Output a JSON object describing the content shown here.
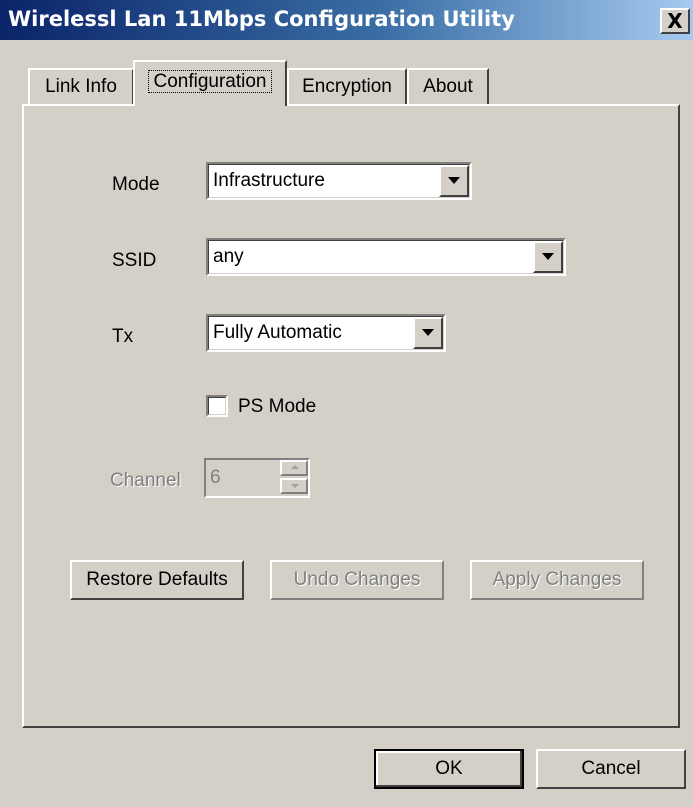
{
  "window": {
    "title": "Wirelessl Lan 11Mbps Configuration Utility",
    "close_label": "X"
  },
  "tabs": [
    {
      "label": "Link Info"
    },
    {
      "label": "Configuration"
    },
    {
      "label": "Encryption"
    },
    {
      "label": "About"
    }
  ],
  "active_tab": "Configuration",
  "form": {
    "mode_label": "Mode",
    "mode_value": "Infrastructure",
    "ssid_label": "SSID",
    "ssid_value": "any",
    "tx_label": "Tx",
    "tx_value": "Fully Automatic",
    "ps_mode_label": "PS Mode",
    "ps_mode_checked": false,
    "channel_label": "Channel",
    "channel_value": "6",
    "channel_enabled": false
  },
  "actions": {
    "restore_label": "Restore Defaults",
    "undo_label": "Undo Changes",
    "apply_label": "Apply Changes"
  },
  "footer": {
    "ok_label": "OK",
    "cancel_label": "Cancel"
  },
  "colors": {
    "face": "#d4d0c8",
    "title_start": "#0a246a",
    "title_end": "#a6caf0"
  }
}
